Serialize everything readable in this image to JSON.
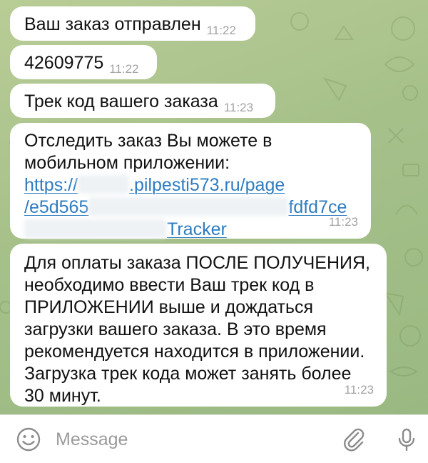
{
  "messages": [
    {
      "text": "Ваш заказ отправлен",
      "time": "11:22"
    },
    {
      "text": "42609775",
      "time": "11:22"
    },
    {
      "text": "Трек код вашего заказа",
      "time": "11:23"
    },
    {
      "line1": "Отследить заказ Вы можете в",
      "line2": "мобильном приложении:",
      "link_part1": "https://",
      "link_part2": ".pilpesti573.ru/page",
      "link_part3": "/e5d565",
      "link_part4": "fdfd7ce",
      "link_part5": "Tracker",
      "time": "11:23"
    },
    {
      "text": "Для оплаты заказа ПОСЛЕ ПОЛУЧЕНИЯ,\nнеобходимо ввести Ваш трек код в\nПРИЛОЖЕНИИ выше и дождаться\nзагрузки вашего заказа. В это время\nрекомендуется находится в приложении.\nЗагрузка трек кода может занять более\n30 минут.",
      "time": "11:23"
    }
  ],
  "input": {
    "placeholder": "Message"
  },
  "icons": {
    "emoji": "smile-icon",
    "attach": "paperclip-icon",
    "voice": "microphone-icon"
  },
  "colors": {
    "bubble": "#ffffff",
    "link": "#2f7cc0",
    "time": "#a3a3a3",
    "background": "#a8c18a"
  }
}
